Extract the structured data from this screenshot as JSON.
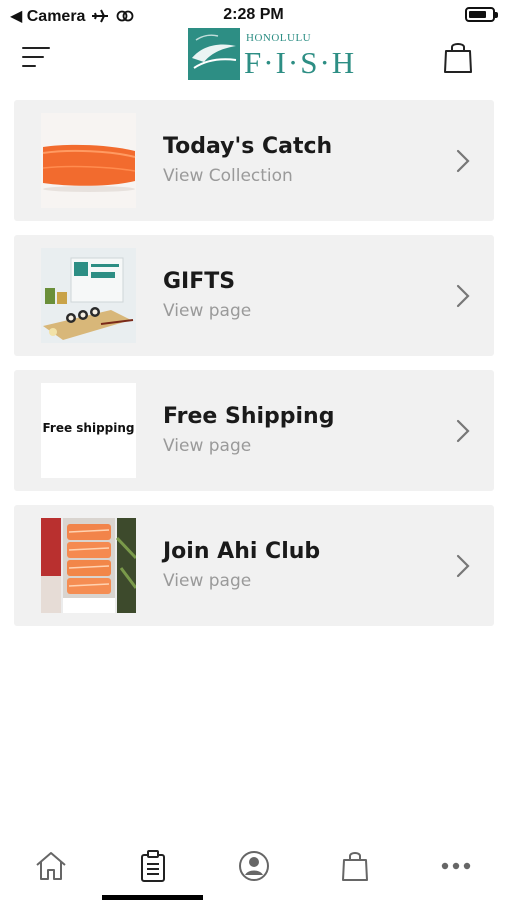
{
  "status_bar": {
    "back_label": "◀ Camera",
    "time": "2:28 PM"
  },
  "header": {
    "logo_top": "HONOLULU",
    "logo_main": "F·I·S·H"
  },
  "collections": [
    {
      "title": "Today's Catch",
      "subtitle": "View Collection",
      "thumb": "salmon-fillet"
    },
    {
      "title": "GIFTS",
      "subtitle": "View page",
      "thumb": "gift-box-sushi"
    },
    {
      "title": "Free Shipping",
      "subtitle": "View page",
      "thumb_text": "Free shipping"
    },
    {
      "title": "Join Ahi Club",
      "subtitle": "View page",
      "thumb": "ahi-club-fish"
    }
  ],
  "bottom_nav": {
    "items": [
      "home-icon",
      "clipboard-icon",
      "account-icon",
      "bag-icon",
      "more-icon"
    ],
    "active_index": 1
  },
  "colors": {
    "brand": "#2d8e84",
    "card_bg": "#f1f1f1",
    "subtitle": "#9a9a9a"
  }
}
